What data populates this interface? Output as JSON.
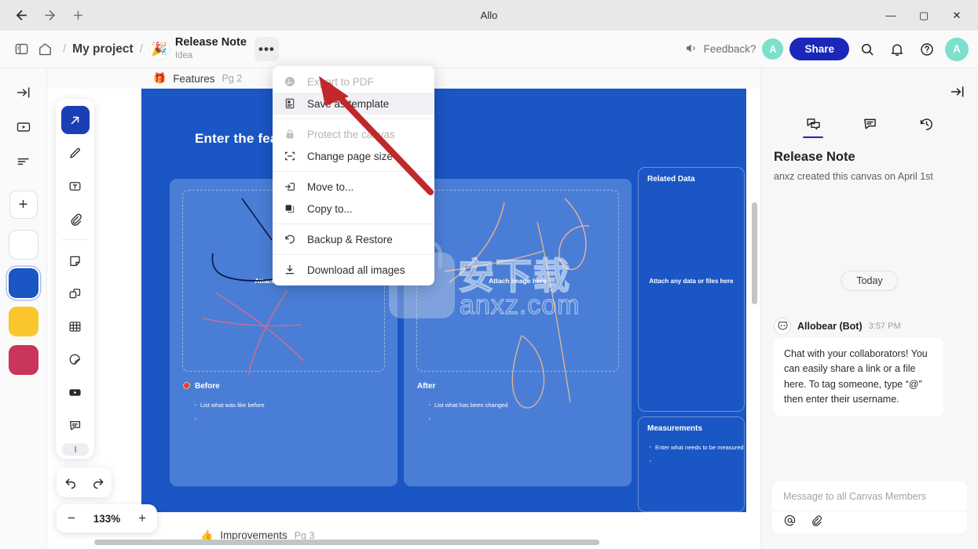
{
  "window": {
    "title": "Allo",
    "back_icon": "back-arrow-icon",
    "forward_icon": "forward-arrow-icon",
    "new_tab_icon": "plus-icon",
    "minimize": "—",
    "maximize": "▢",
    "close": "✕"
  },
  "header": {
    "sidebar_toggle_icon": "panel-toggle-icon",
    "home_icon": "home-icon",
    "separator": "/",
    "project": "My project",
    "doc_emoji": "🎉",
    "doc_title": "Release Note",
    "doc_subtitle": "Idea",
    "more_label": "•••",
    "feedback_label": "Feedback?",
    "avatar_initial": "A",
    "share_label": "Share",
    "search_icon": "search-icon",
    "bell_icon": "notification-bell-icon",
    "help_icon": "help-circle-icon",
    "profile_initial": "A"
  },
  "left_rail": {
    "items": [
      {
        "name": "collapse-panel",
        "icon": "arrow-to-line-icon"
      },
      {
        "name": "present",
        "icon": "presentation-icon"
      },
      {
        "name": "outline",
        "icon": "outline-list-icon"
      }
    ],
    "add_label": "+",
    "swatches": [
      {
        "name": "page-white",
        "color": "#ffffff",
        "selected": false
      },
      {
        "name": "page-blue",
        "color": "#1a56c4",
        "selected": true
      },
      {
        "name": "page-yellow",
        "color": "#fbc52d",
        "selected": false
      },
      {
        "name": "page-red",
        "color": "#c9365a",
        "selected": false
      }
    ]
  },
  "toolbar": {
    "tools": [
      {
        "name": "select-cursor",
        "icon": "cursor-arrow-icon",
        "active": true
      },
      {
        "name": "pen",
        "icon": "pen-icon",
        "active": false
      },
      {
        "name": "text",
        "icon": "text-box-icon",
        "active": false
      },
      {
        "name": "attachment",
        "icon": "paperclip-icon",
        "active": false
      },
      {
        "name": "sticky-note",
        "icon": "note-icon",
        "active": false
      },
      {
        "name": "shapes",
        "icon": "shapes-icon",
        "active": false
      },
      {
        "name": "table",
        "icon": "table-grid-icon",
        "active": false
      },
      {
        "name": "sticker",
        "icon": "sticker-icon",
        "active": false
      },
      {
        "name": "video",
        "icon": "youtube-icon",
        "active": false
      },
      {
        "name": "comment",
        "icon": "comment-icon",
        "active": false
      }
    ],
    "undo_icon": "undo-arrow-icon",
    "redo_icon": "redo-arrow-icon",
    "zoom_out": "−",
    "zoom_level": "133%",
    "zoom_in": "+"
  },
  "tabs": {
    "current": {
      "emoji": "🎁",
      "label": "Features",
      "page": "Pg 2"
    },
    "next": {
      "emoji": "👍",
      "label": "Improvements",
      "page": "Pg 3"
    }
  },
  "menu": {
    "items": [
      {
        "label": "Export to PDF",
        "icon": "pdf-icon",
        "disabled": true,
        "hover": false
      },
      {
        "label": "Save as template",
        "icon": "template-icon",
        "disabled": false,
        "hover": true
      },
      {
        "divider_after": true
      },
      {
        "label": "Protect the canvas",
        "icon": "lock-icon",
        "disabled": true,
        "hover": false
      },
      {
        "label": "Change page size",
        "icon": "resize-frame-icon",
        "disabled": false,
        "hover": false
      },
      {
        "divider_after": true
      },
      {
        "label": "Move to...",
        "icon": "move-to-icon",
        "disabled": false,
        "hover": false
      },
      {
        "label": "Copy to...",
        "icon": "copy-to-icon",
        "disabled": false,
        "hover": false
      },
      {
        "divider_after": true
      },
      {
        "label": "Backup & Restore",
        "icon": "restore-icon",
        "disabled": false,
        "hover": false
      },
      {
        "divider_after": true
      },
      {
        "label": "Download all images",
        "icon": "download-icon",
        "disabled": false,
        "hover": false
      }
    ]
  },
  "canvas": {
    "title": "Enter the feature name",
    "watermark_cn": "安下载",
    "watermark_domain": "anxz.com",
    "cards": [
      {
        "name": "before-card",
        "attach_label": "Attach image here",
        "heading": "Before",
        "has_red_dot": true,
        "bullets": [
          "List what was like before",
          ""
        ]
      },
      {
        "name": "after-card",
        "attach_label": "Attach image here",
        "heading": "After",
        "has_red_dot": false,
        "bullets": [
          "List what has been changed",
          ""
        ]
      }
    ],
    "side_cards": [
      {
        "name": "related-data-card",
        "heading": "Related Data",
        "body": "Attach any data or files here",
        "bullets": []
      },
      {
        "name": "measurements-card",
        "heading": "Measurements",
        "body": "",
        "bullets": [
          "Enter what needs to be measured",
          ""
        ]
      }
    ]
  },
  "right_panel": {
    "collapse_icon": "arrow-to-line-icon",
    "tabs": [
      {
        "name": "chat",
        "icon": "chat-bubbles-icon",
        "active": true
      },
      {
        "name": "comments",
        "icon": "comment-icon",
        "active": false
      },
      {
        "name": "history",
        "icon": "history-clock-icon",
        "active": false
      }
    ],
    "title": "Release Note",
    "subtitle": "anxz created this canvas on April 1st",
    "date_chip": "Today",
    "message": {
      "author": "Allobear (Bot)",
      "time": "3:57 PM",
      "text": "Chat with your collaborators! You can easily share a link or a file here. To tag someone, type “@” then enter their username."
    },
    "composer": {
      "placeholder": "Message to all Canvas Members",
      "mention_icon": "at-mention-icon",
      "attach_icon": "paperclip-icon"
    }
  },
  "colors": {
    "canvas_bg": "#1a56c4",
    "card_bg": "#4a7ed6",
    "brand_blue": "#1a27b8",
    "accent_teal": "#7ce0cd",
    "annotation_red": "#c0282a"
  }
}
